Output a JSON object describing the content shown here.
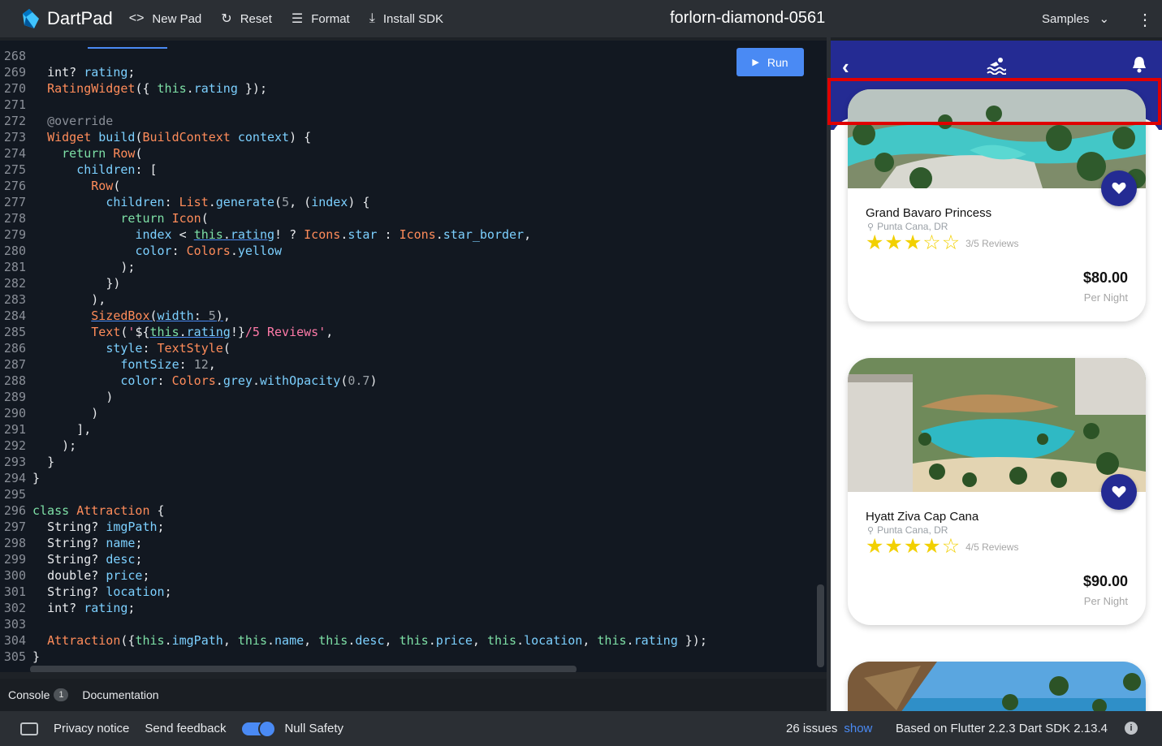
{
  "app": {
    "name": "DartPad",
    "new_pad": "New Pad",
    "reset": "Reset",
    "format": "Format",
    "install_sdk": "Install SDK",
    "pad_title": "forlorn-diamond-0561",
    "samples": "Samples",
    "run": "Run"
  },
  "code_lines": [
    {
      "n": "268",
      "html": ""
    },
    {
      "n": "269",
      "html": "  <span class='pl'>int? </span><span class='pr'>rating</span><span class='pl'>;</span>"
    },
    {
      "n": "270",
      "html": "  <span class='kw'>RatingWidget</span><span class='pl'>({ </span><span class='fn'>this</span><span class='pl'>.</span><span class='pr'>rating</span><span class='pl'> });</span>"
    },
    {
      "n": "271",
      "html": ""
    },
    {
      "n": "272",
      "html": "  <span class='an'>@override</span>"
    },
    {
      "n": "273",
      "html": "  <span class='kw'>Widget</span><span class='pl'> </span><span class='pr'>build</span><span class='pl'>(</span><span class='kw'>BuildContext</span><span class='pl'> </span><span class='pr'>context</span><span class='pl'>) {</span>"
    },
    {
      "n": "274",
      "html": "    <span class='fn'>return</span><span class='pl'> </span><span class='kw'>Row</span><span class='pl'>(</span>"
    },
    {
      "n": "275",
      "html": "      <span class='pr'>children</span><span class='pl'>: [</span>"
    },
    {
      "n": "276",
      "html": "        <span class='kw'>Row</span><span class='pl'>(</span>"
    },
    {
      "n": "277",
      "html": "          <span class='pr'>children</span><span class='pl'>: </span><span class='kw'>List</span><span class='pl'>.</span><span class='pr'>generate</span><span class='pl'>(</span><span class='nm'>5</span><span class='pl'>, (</span><span class='pr'>index</span><span class='pl'>) {</span>"
    },
    {
      "n": "278",
      "html": "            <span class='fn'>return</span><span class='pl'> </span><span class='kw'>Icon</span><span class='pl'>(</span>"
    },
    {
      "n": "279",
      "html": "              <span class='pr'>index</span><span class='pl'> &lt; </span><span class='underline'><span class='fn'>this</span><span class='pl'>.</span><span class='pr'>rating</span></span><span class='pl'>! ? </span><span class='kw'>Icons</span><span class='pl'>.</span><span class='pr'>star</span><span class='pl'> : </span><span class='kw'>Icons</span><span class='pl'>.</span><span class='pr'>star_border</span><span class='pl'>,</span>"
    },
    {
      "n": "280",
      "html": "              <span class='pr'>color</span><span class='pl'>: </span><span class='kw'>Colors</span><span class='pl'>.</span><span class='pr'>yellow</span>"
    },
    {
      "n": "281",
      "html": "            <span class='pl'>);</span>"
    },
    {
      "n": "282",
      "html": "          <span class='pl'>})</span>"
    },
    {
      "n": "283",
      "html": "        <span class='pl'>),</span>"
    },
    {
      "n": "284",
      "html": "        <span class='underline'><span class='kw'>SizedBox</span><span class='pl'>(</span><span class='pr'>width</span><span class='pl'>: </span><span class='nm'>5</span><span class='pl'>)</span></span><span class='pl'>,</span>"
    },
    {
      "n": "285",
      "html": "        <span class='kw'>Text</span><span class='pl'>(</span><span class='st'>'</span><span class='pl'>${</span><span class='underline'><span class='fn'>this</span><span class='pl'>.</span><span class='pr'>rating</span></span><span class='pl'>!}</span><span class='st'>/5 Reviews'</span><span class='pl'>,</span>"
    },
    {
      "n": "286",
      "html": "          <span class='pr'>style</span><span class='pl'>: </span><span class='kw'>TextStyle</span><span class='pl'>(</span>"
    },
    {
      "n": "287",
      "html": "            <span class='pr'>fontSize</span><span class='pl'>: </span><span class='nm'>12</span><span class='pl'>,</span>"
    },
    {
      "n": "288",
      "html": "            <span class='pr'>color</span><span class='pl'>: </span><span class='kw'>Colors</span><span class='pl'>.</span><span class='pr'>grey</span><span class='pl'>.</span><span class='pr'>withOpacity</span><span class='pl'>(</span><span class='nm'>0.7</span><span class='pl'>)</span>"
    },
    {
      "n": "289",
      "html": "          <span class='pl'>)</span>"
    },
    {
      "n": "290",
      "html": "        <span class='pl'>)</span>"
    },
    {
      "n": "291",
      "html": "      <span class='pl'>],</span>"
    },
    {
      "n": "292",
      "html": "    <span class='pl'>);</span>"
    },
    {
      "n": "293",
      "html": "  <span class='pl'>}</span>"
    },
    {
      "n": "294",
      "html": "<span class='pl'>}</span>"
    },
    {
      "n": "295",
      "html": ""
    },
    {
      "n": "296",
      "html": "<span class='fn'>class</span><span class='pl'> </span><span class='kw'>Attraction</span><span class='pl'> {</span>"
    },
    {
      "n": "297",
      "html": "  <span class='pl'>String? </span><span class='pr'>imgPath</span><span class='pl'>;</span>"
    },
    {
      "n": "298",
      "html": "  <span class='pl'>String? </span><span class='pr'>name</span><span class='pl'>;</span>"
    },
    {
      "n": "299",
      "html": "  <span class='pl'>String? </span><span class='pr'>desc</span><span class='pl'>;</span>"
    },
    {
      "n": "300",
      "html": "  <span class='pl'>double? </span><span class='pr'>price</span><span class='pl'>;</span>"
    },
    {
      "n": "301",
      "html": "  <span class='pl'>String? </span><span class='pr'>location</span><span class='pl'>;</span>"
    },
    {
      "n": "302",
      "html": "  <span class='pl'>int? </span><span class='pr'>rating</span><span class='pl'>;</span>"
    },
    {
      "n": "303",
      "html": ""
    },
    {
      "n": "304",
      "html": "  <span class='kw'>Attraction</span><span class='pl'>({</span><span class='fn'>this</span><span class='pl'>.</span><span class='pr'>imgPath</span><span class='pl'>, </span><span class='fn'>this</span><span class='pl'>.</span><span class='pr'>name</span><span class='pl'>, </span><span class='fn'>this</span><span class='pl'>.</span><span class='pr'>desc</span><span class='pl'>, </span><span class='fn'>this</span><span class='pl'>.</span><span class='pr'>price</span><span class='pl'>, </span><span class='fn'>this</span><span class='pl'>.</span><span class='pr'>location</span><span class='pl'>, </span><span class='fn'>this</span><span class='pl'>.</span><span class='pr'>rating</span><span class='pl'> });</span>"
    },
    {
      "n": "305",
      "html": "<span class='pl'>}</span>"
    }
  ],
  "console": {
    "label": "Console",
    "count": "1",
    "documentation": "Documentation"
  },
  "footer": {
    "privacy": "Privacy notice",
    "feedback": "Send feedback",
    "null_safety": "Null Safety",
    "issues": "26 issues",
    "show": "show",
    "flutter": "Based on Flutter 2.2.3 Dart SDK 2.13.4"
  },
  "cards": [
    {
      "name": "Grand Bavaro Princess",
      "location": "Punta Cana, DR",
      "rating": 3,
      "reviews": "3/5 Reviews",
      "price": "$80.00",
      "per": "Per Night"
    },
    {
      "name": "Hyatt Ziva Cap Cana",
      "location": "Punta Cana, DR",
      "rating": 4,
      "reviews": "4/5 Reviews",
      "price": "$90.00",
      "per": "Per Night"
    }
  ],
  "colors": {
    "accent": "#4a8af4",
    "appbar": "#242b93",
    "star": "#f2d000",
    "highlight": "#e00000"
  }
}
